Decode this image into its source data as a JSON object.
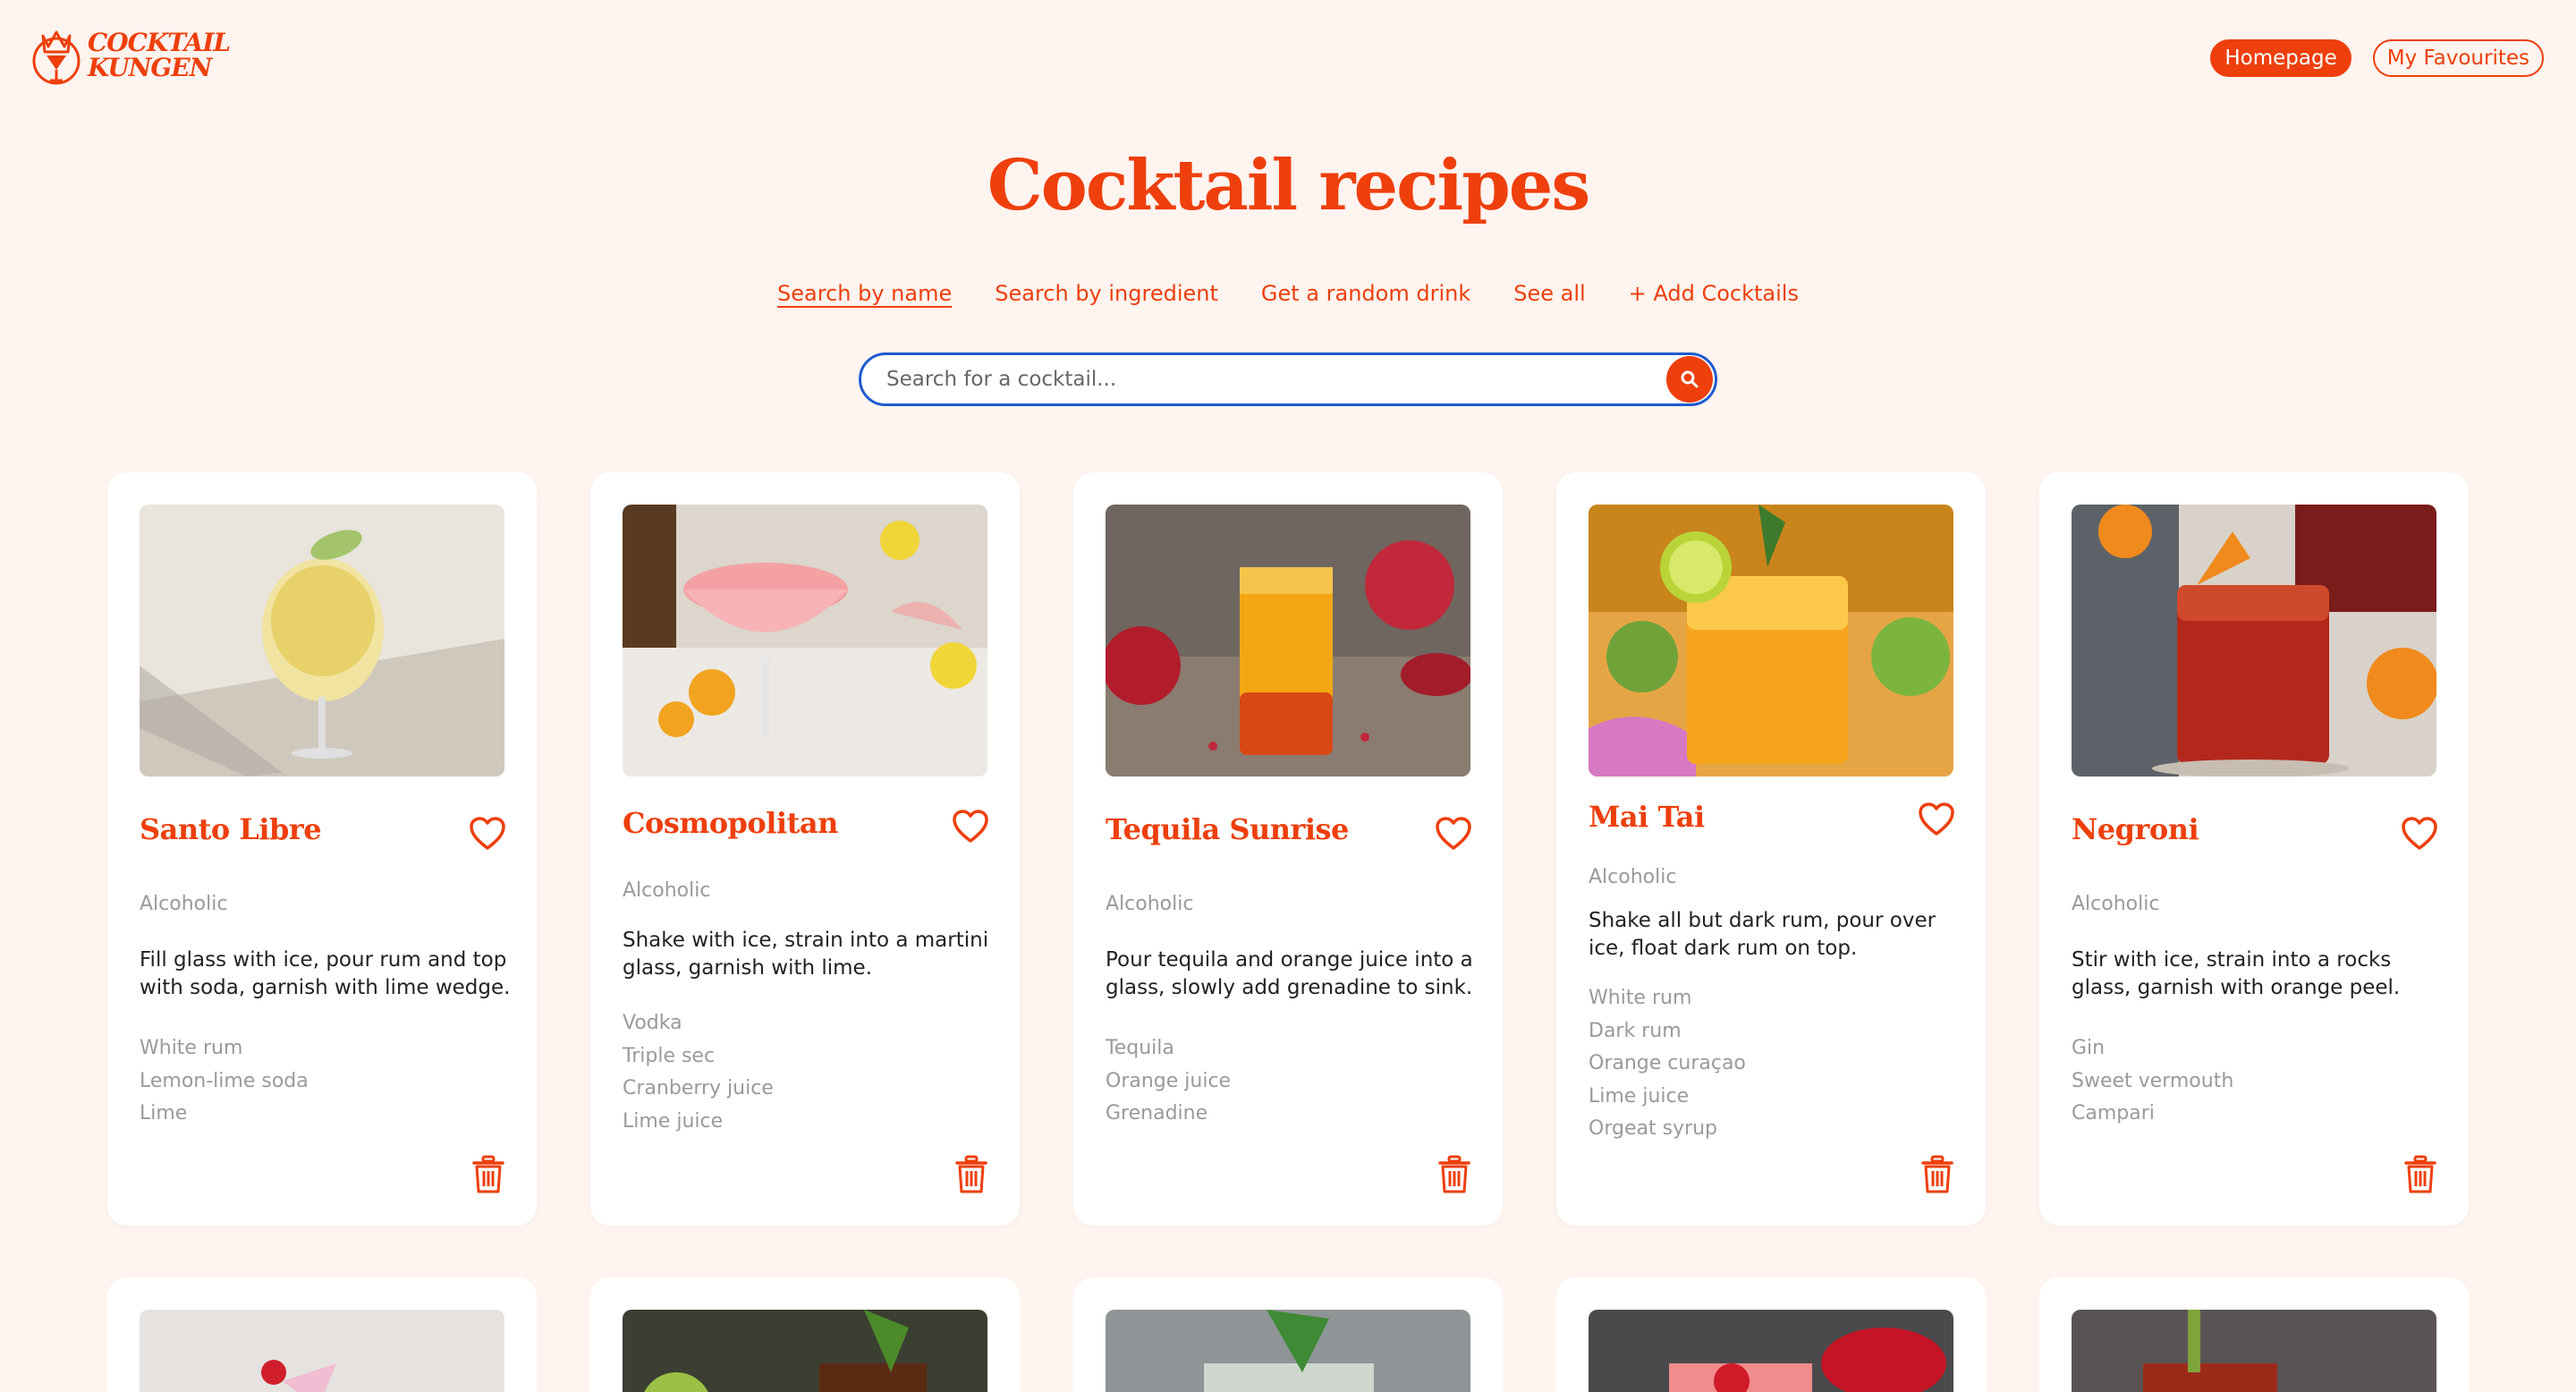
{
  "brand": {
    "line1": "COCKTAIL",
    "line2": "KUNGEN"
  },
  "nav": {
    "homepage": "Homepage",
    "favourites": "My Favourites"
  },
  "title": "Cocktail recipes",
  "tabs": [
    "Search by name",
    "Search by ingredient",
    "Get a random drink",
    "See all",
    "+ Add Cocktails"
  ],
  "search": {
    "placeholder": "Search for a cocktail...",
    "value": ""
  },
  "colors": {
    "accent": "#ee3f0c",
    "background": "#fff4ef",
    "focus_ring": "#1e5bd0"
  },
  "cocktails": [
    {
      "name": "Santo Libre",
      "category": "Alcoholic",
      "instructions": "Fill glass with ice, pour rum and top with soda, garnish with lime wedge.",
      "ingredients": [
        "White rum",
        "Lemon-lime soda",
        "Lime"
      ]
    },
    {
      "name": "Cosmopolitan",
      "category": "Alcoholic",
      "instructions": "Shake with ice, strain into a martini glass, garnish with lime.",
      "ingredients": [
        "Vodka",
        "Triple sec",
        "Cranberry juice",
        "Lime juice"
      ]
    },
    {
      "name": "Tequila Sunrise",
      "category": "Alcoholic",
      "instructions": "Pour tequila and orange juice into a glass, slowly add grenadine to sink.",
      "ingredients": [
        "Tequila",
        "Orange juice",
        "Grenadine"
      ]
    },
    {
      "name": "Mai Tai",
      "category": "Alcoholic",
      "instructions": "Shake all but dark rum, pour over ice, float dark rum on top.",
      "ingredients": [
        "White rum",
        "Dark rum",
        "Orange curaçao",
        "Lime juice",
        "Orgeat syrup"
      ]
    },
    {
      "name": "Negroni",
      "category": "Alcoholic",
      "instructions": "Stir with ice, strain into a rocks glass, garnish with orange peel.",
      "ingredients": [
        "Gin",
        "Sweet vermouth",
        "Campari"
      ]
    }
  ]
}
